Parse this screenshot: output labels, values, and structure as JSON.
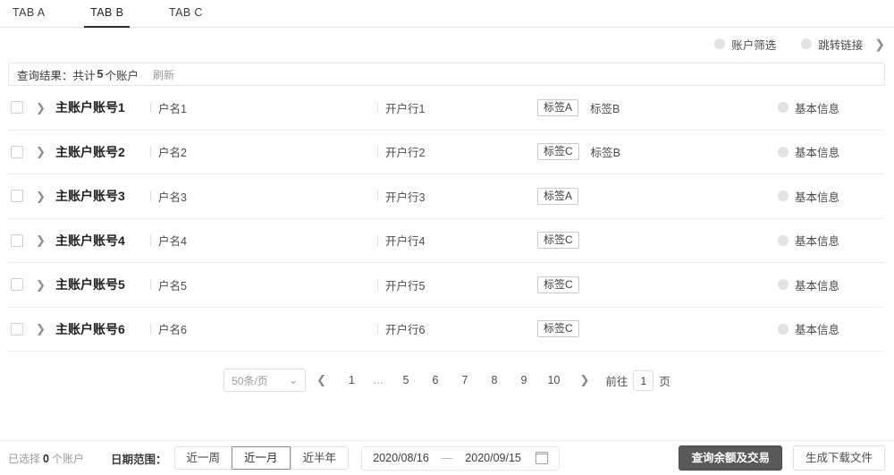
{
  "tabs": [
    {
      "label": "TAB A",
      "active": false
    },
    {
      "label": "TAB B",
      "active": true
    },
    {
      "label": "TAB C",
      "active": false
    }
  ],
  "top_toggles": [
    {
      "label": "账户筛选"
    },
    {
      "label": "跳转链接"
    }
  ],
  "top_chevron": "❯",
  "result_bar": {
    "prefix": "查询结果：共计",
    "count": "5",
    "suffix": "个账户",
    "refresh_label": "刷新"
  },
  "table": {
    "chevron": "❯",
    "rows": [
      {
        "account": "主账户账号1",
        "name": "户名1",
        "bank": "开户行1",
        "tag_box": "标签A",
        "tag_plain": "标签B",
        "info": "基本信息"
      },
      {
        "account": "主账户账号2",
        "name": "户名2",
        "bank": "开户行2",
        "tag_box": "标签C",
        "tag_plain": "标签B",
        "info": "基本信息"
      },
      {
        "account": "主账户账号3",
        "name": "户名3",
        "bank": "开户行3",
        "tag_box": "标签A",
        "tag_plain": "",
        "info": "基本信息"
      },
      {
        "account": "主账户账号4",
        "name": "户名4",
        "bank": "开户行4",
        "tag_box": "标签C",
        "tag_plain": "",
        "info": "基本信息"
      },
      {
        "account": "主账户账号5",
        "name": "户名5",
        "bank": "开户行5",
        "tag_box": "标签C",
        "tag_plain": "",
        "info": "基本信息"
      },
      {
        "account": "主账户账号6",
        "name": "户名6",
        "bank": "开户行6",
        "tag_box": "标签C",
        "tag_plain": "",
        "info": "基本信息"
      }
    ]
  },
  "pagination": {
    "page_size": "50条/页",
    "page_size_caret": "⌄",
    "prev": "❮",
    "next": "❯",
    "pages": [
      "1",
      "…",
      "5",
      "6",
      "7",
      "8",
      "9",
      "10"
    ],
    "goto_label": "前往",
    "goto_value": "1",
    "page_unit": "页"
  },
  "footer": {
    "selected_prefix": "已选择",
    "selected_count": "0",
    "selected_suffix": "个账户",
    "date_range_label": "日期范围：",
    "segments": [
      {
        "label": "近一周",
        "selected": false
      },
      {
        "label": "近一月",
        "selected": true
      },
      {
        "label": "近半年",
        "selected": false
      }
    ],
    "date_start": "2020/08/16",
    "date_dash": "—",
    "date_end": "2020/09/15",
    "primary_button": "查询余额及交易",
    "default_button": "生成下载文件"
  },
  "colors": {
    "accent_dark": "#595959",
    "tab_underline": "#2b2b2b",
    "muted": "#9a9a9a"
  }
}
